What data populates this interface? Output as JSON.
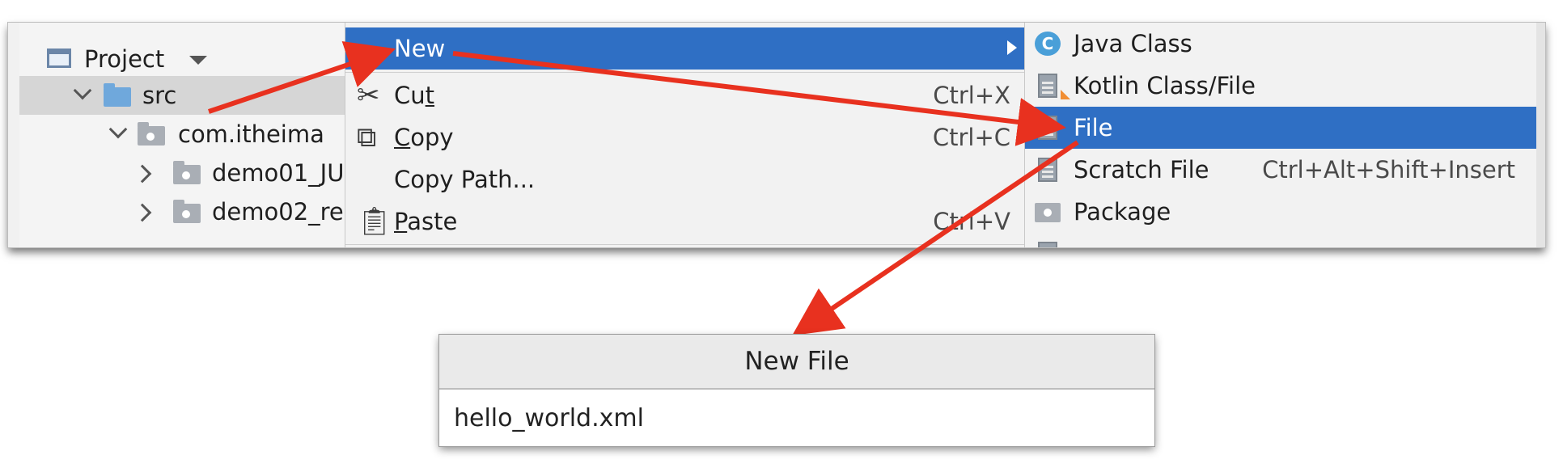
{
  "project_panel": {
    "header_label": "Project",
    "tree": [
      {
        "label": "src"
      },
      {
        "label": "com.itheima"
      },
      {
        "label": "demo01_JU"
      },
      {
        "label": "demo02_re"
      }
    ]
  },
  "context_menu": {
    "items": [
      {
        "label": "New"
      },
      {
        "label_pre": "Cu",
        "label_mn": "t",
        "label_post": "",
        "shortcut": "Ctrl+X",
        "icon": "scissors-icon"
      },
      {
        "label_pre": "",
        "label_mn": "C",
        "label_post": "opy",
        "shortcut": "Ctrl+C",
        "icon": "copy-icon"
      },
      {
        "label": "Copy Path..."
      },
      {
        "label_pre": "",
        "label_mn": "P",
        "label_post": "aste",
        "shortcut": "Ctrl+V",
        "icon": "clipboard-icon"
      }
    ]
  },
  "new_submenu": {
    "items": [
      {
        "label": "Java Class",
        "icon": "java-class-icon",
        "icon_glyph": "C"
      },
      {
        "label": "Kotlin Class/File",
        "icon": "kotlin-file-icon"
      },
      {
        "label": "File",
        "icon": "file-icon"
      },
      {
        "label": "Scratch File",
        "shortcut": "Ctrl+Alt+Shift+Insert",
        "icon": "scratch-file-icon"
      },
      {
        "label": "Package",
        "icon": "package-icon"
      }
    ]
  },
  "new_file_dialog": {
    "title": "New File",
    "input_value": "hello_world.xml"
  },
  "colors": {
    "highlight": "#2f6fc4",
    "annotation_arrow": "#e8311f"
  }
}
